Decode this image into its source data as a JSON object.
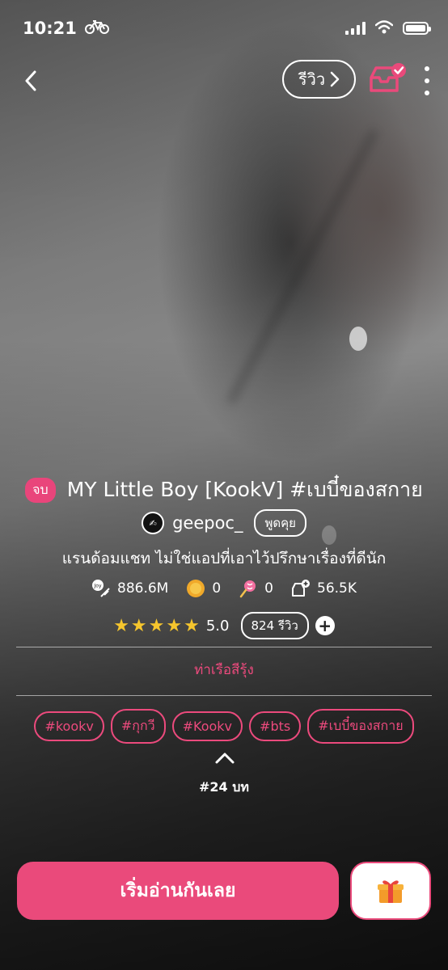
{
  "status_bar": {
    "time": "10:21",
    "activity_icon": "bicycle-icon",
    "signal_icon": "cellular-signal-icon",
    "wifi_icon": "wifi-icon",
    "battery_icon": "battery-icon"
  },
  "nav": {
    "back_icon": "chevron-left-icon",
    "review_label": "รีวิว",
    "library_icon": "inbox-check-icon",
    "more_icon": "more-vertical-icon"
  },
  "story": {
    "status_badge": "จบ",
    "title": "MY Little Boy [KookV] #เบบี๋ของสกาย",
    "author": "geepoc_",
    "chat_label": "พูดคุย",
    "description": "แรนด้อมแชท ไม่ใช่แอปที่เอาไว้ปรึกษาเรื่องที่ดีนัก",
    "stats": {
      "views": "886.6M",
      "coins": "0",
      "candies": "0",
      "library_adds": "56.5K"
    },
    "rating": {
      "stars": 5,
      "score": "5.0",
      "review_count": "824 รีวิว"
    },
    "category": "ท่าเรือสีรุ้ง",
    "tags": [
      "#kookv",
      "#กุกวี",
      "#Kookv",
      "#bts",
      "#เบบี๋ของสกาย"
    ],
    "chapter_count": "#24 บท"
  },
  "actions": {
    "read_label": "เริ่มอ่านกันเลย",
    "gift_icon": "gift-box-icon"
  },
  "colors": {
    "accent": "#ea4a7b",
    "star": "#f6c62d"
  }
}
